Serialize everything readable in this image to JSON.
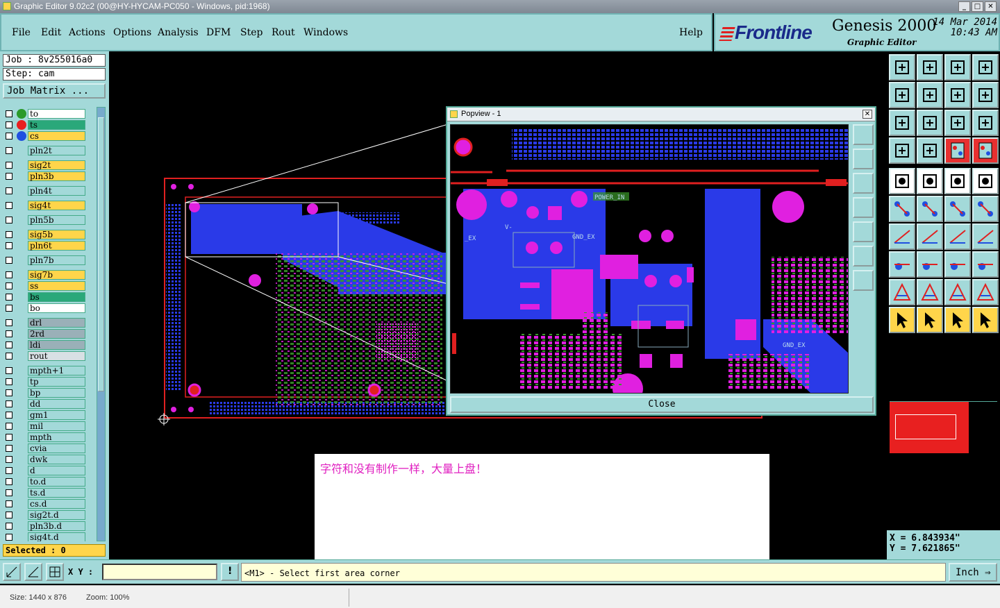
{
  "window": {
    "title": "Graphic Editor 9.02c2 (00@HY-HYCAM-PC050 - Windows, pid:1968)"
  },
  "menu": {
    "items": [
      {
        "label": "File"
      },
      {
        "label": "Edit"
      },
      {
        "label": "Actions"
      },
      {
        "label": "Options"
      },
      {
        "label": "Analysis"
      },
      {
        "label": "DFM"
      },
      {
        "label": "Step"
      },
      {
        "label": "Rout"
      },
      {
        "label": "Windows"
      }
    ],
    "help": "Help"
  },
  "brand": {
    "logo": "Frontline",
    "product": "Genesis 2000",
    "subtitle": "Graphic Editor",
    "date": "14 Mar 2014",
    "time": "10:43 AM"
  },
  "job": {
    "job_label": "Job : 8v255016a0",
    "step_label": "Step: cam",
    "matrix_button": "Job Matrix ..."
  },
  "layers": [
    {
      "name": "to",
      "color": "#ffffff",
      "dot": "#2a9a2a",
      "flag": "✎▪"
    },
    {
      "name": "ts",
      "color": "#2aa87a",
      "dot": "#e82020",
      "flag": "✎"
    },
    {
      "name": "cs",
      "color": "#ffd54a",
      "dot": "#2050e0",
      "flag": "✎"
    },
    {
      "name": "pln2t",
      "color": "#a3d9d9"
    },
    {
      "name": "sig2t",
      "color": "#ffd54a"
    },
    {
      "name": "pln3b",
      "color": "#ffd54a"
    },
    {
      "name": "pln4t",
      "color": "#a3d9d9"
    },
    {
      "name": "sig4t",
      "color": "#ffd54a"
    },
    {
      "name": "pln5b",
      "color": "#a3d9d9"
    },
    {
      "name": "sig5b",
      "color": "#ffd54a"
    },
    {
      "name": "pln6t",
      "color": "#ffd54a"
    },
    {
      "name": "pln7b",
      "color": "#a3d9d9"
    },
    {
      "name": "sig7b",
      "color": "#ffd54a"
    },
    {
      "name": "ss",
      "color": "#ffd54a"
    },
    {
      "name": "bs",
      "color": "#2aa87a",
      "flag": "✎"
    },
    {
      "name": "bo",
      "color": "#ffffff"
    },
    {
      "name": "drl",
      "color": "#9ab0b8"
    },
    {
      "name": "2rd",
      "color": "#9ab0b8"
    },
    {
      "name": "ldi",
      "color": "#9ab0b8"
    },
    {
      "name": "rout",
      "color": "#d8e0e4"
    },
    {
      "name": "mpth+1",
      "color": "#a3d9d9"
    },
    {
      "name": "tp",
      "color": "#a3d9d9"
    },
    {
      "name": "bp",
      "color": "#a3d9d9"
    },
    {
      "name": "dd",
      "color": "#a3d9d9",
      "flag": "✎"
    },
    {
      "name": "gm1",
      "color": "#a3d9d9"
    },
    {
      "name": "mil",
      "color": "#a3d9d9"
    },
    {
      "name": "mpth",
      "color": "#a3d9d9"
    },
    {
      "name": "cvia",
      "color": "#a3d9d9"
    },
    {
      "name": "dwk",
      "color": "#a3d9d9"
    },
    {
      "name": "d",
      "color": "#a3d9d9"
    },
    {
      "name": "to.d",
      "color": "#a3d9d9",
      "flag": "✎"
    },
    {
      "name": "ts.d",
      "color": "#a3d9d9",
      "flag": "✎"
    },
    {
      "name": "cs.d",
      "color": "#a3d9d9",
      "flag": "✎"
    },
    {
      "name": "sig2t.d",
      "color": "#a3d9d9"
    },
    {
      "name": "pln3b.d",
      "color": "#a3d9d9"
    },
    {
      "name": "sig4t.d",
      "color": "#a3d9d9"
    }
  ],
  "selected_label": "Selected : 0",
  "popview": {
    "title": "Popview - 1",
    "close_button": "Close",
    "silk_labels": [
      "POWER_IN",
      "_EX",
      "GND_EX",
      "V-",
      "GND_EX"
    ]
  },
  "note": {
    "text": "字符和没有制作一样，大量上盘！"
  },
  "coords": {
    "x": "X = 6.843934\"",
    "y": "Y = 7.621865\""
  },
  "command": {
    "xy_label": "X Y :",
    "xy_value": "",
    "message": "<M1> - Select first area corner",
    "unit": "Inch"
  },
  "status": {
    "size": "Size: 1440 x 876",
    "zoom": "Zoom: 100%"
  },
  "colors": {
    "panel": "#a3d9d9",
    "highlight": "#ffd54a",
    "board_blue": "#2a3ae8",
    "pad_magenta": "#e020e0",
    "outline_red": "#e02020"
  }
}
